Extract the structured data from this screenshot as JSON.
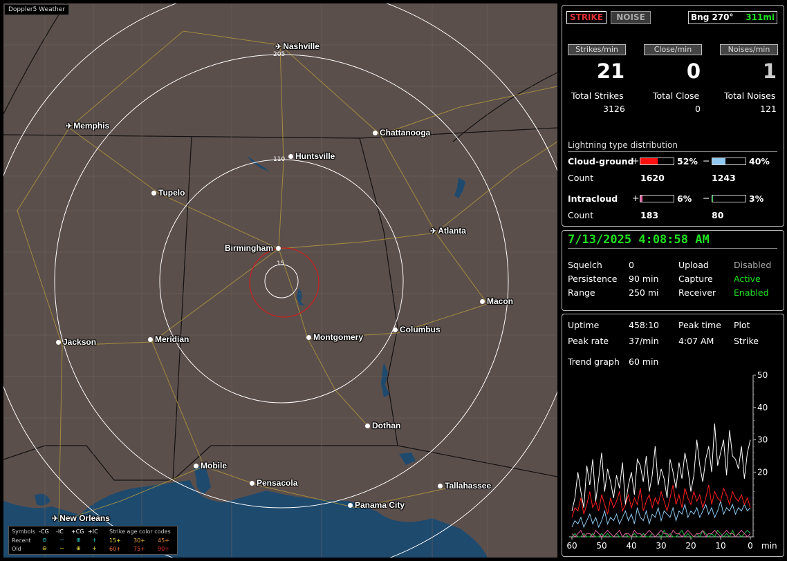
{
  "app": {
    "title": "Doppler5 Weather"
  },
  "map": {
    "cities": [
      {
        "name": "Nashville",
        "marker": "airport"
      },
      {
        "name": "Memphis",
        "marker": "airport"
      },
      {
        "name": "Chattanooga",
        "marker": "dot"
      },
      {
        "name": "Huntsville",
        "marker": "dot"
      },
      {
        "name": "Tupelo",
        "marker": "dot"
      },
      {
        "name": "Atlanta",
        "marker": "airport"
      },
      {
        "name": "Birmingham",
        "marker": "dot"
      },
      {
        "name": "Macon",
        "marker": "dot"
      },
      {
        "name": "Columbus",
        "marker": "dot"
      },
      {
        "name": "Montgomery",
        "marker": "dot"
      },
      {
        "name": "Meridian",
        "marker": "dot"
      },
      {
        "name": "Jackson",
        "marker": "dot"
      },
      {
        "name": "Dothan",
        "marker": "dot"
      },
      {
        "name": "Mobile",
        "marker": "dot"
      },
      {
        "name": "Pensacola",
        "marker": "dot"
      },
      {
        "name": "Tallahassee",
        "marker": "dot"
      },
      {
        "name": "Panama City",
        "marker": "dot"
      },
      {
        "name": "New Orleans",
        "marker": "airport"
      }
    ],
    "ring_labels": [
      "205",
      "110",
      "15"
    ],
    "colors": {
      "land": "#5b4f4c",
      "water": "#1e4a6e",
      "state_border": "#111111",
      "road": "#b59a3a",
      "ring": "#ffffff",
      "strike_range": "#cc2020"
    }
  },
  "legend": {
    "symbols_label": "Symbols",
    "minus_cg": "-CG",
    "minus_ic": "-IC",
    "plus_cg": "+CG",
    "plus_ic": "+IC",
    "age_title": "Strike age color codes",
    "recent_label": "Recent",
    "old_label": "Old",
    "recent_ages": [
      "15+",
      "30+",
      "45+"
    ],
    "old_ages": [
      "60+",
      "75+",
      "90+"
    ]
  },
  "status": {
    "strike_btn": "STRIKE",
    "noise_btn": "NOISE",
    "bearing": "Bng 270°",
    "distance": "311mi",
    "headers": {
      "strikes": "Strikes/min",
      "close": "Close/min",
      "noises": "Noises/min"
    },
    "strikes_per_min": "21",
    "close_per_min": "0",
    "noises_per_min": "1",
    "totals": {
      "strikes_label": "Total Strikes",
      "strikes": "3126",
      "close_label": "Total Close",
      "close": "0",
      "noises_label": "Total Noises",
      "noises": "121"
    }
  },
  "distribution": {
    "title": "Lightning type distribution",
    "cg_label": "Cloud-ground",
    "cg_pos_sign": "+",
    "cg_pos_pct": "52%",
    "cg_pos_value": 0.52,
    "cg_neg_sign": "−",
    "cg_neg_pct": "40%",
    "cg_neg_value": 0.4,
    "count_label": "Count",
    "cg_pos_count": "1620",
    "cg_neg_count": "1243",
    "ic_label": "Intracloud",
    "ic_pos_sign": "+",
    "ic_pos_pct": "6%",
    "ic_pos_value": 0.06,
    "ic_neg_sign": "−",
    "ic_neg_pct": "3%",
    "ic_neg_value": 0.03,
    "ic_pos_count": "183",
    "ic_neg_count": "80",
    "colors": {
      "cg_pos": "#ff1010",
      "cg_neg": "#8fc8f0",
      "ic_pos": "#e060a0",
      "ic_neg": "#20c040"
    }
  },
  "settings": {
    "datetime": "7/13/2025 4:08:58 AM",
    "squelch_label": "Squelch",
    "squelch": "0",
    "persistence_label": "Persistence",
    "persistence": "90 min",
    "range_label": "Range",
    "range": "250 mi",
    "upload_label": "Upload",
    "upload": "Disabled",
    "capture_label": "Capture",
    "capture": "Active",
    "receiver_label": "Receiver",
    "receiver": "Enabled"
  },
  "stats": {
    "uptime_label": "Uptime",
    "uptime": "458:10",
    "peak_time_label": "Peak time",
    "peak_time": "4:07 AM",
    "plot_label": "Plot",
    "plot": "Strike",
    "peak_rate_label": "Peak rate",
    "peak_rate": "37/min",
    "trend_label": "Trend graph",
    "trend": "60 min"
  },
  "chart_data": {
    "type": "line",
    "x_ticks": [
      "60",
      "50",
      "40",
      "30",
      "20",
      "10",
      "0"
    ],
    "x_unit": "min",
    "y_ticks": [
      "50",
      "40",
      "30",
      "20"
    ],
    "ylim": [
      0,
      50
    ],
    "xlim": [
      60,
      0
    ],
    "series": [
      {
        "color": "#ffffff",
        "values": [
          8,
          12,
          20,
          14,
          9,
          22,
          16,
          24,
          11,
          18,
          26,
          14,
          21,
          17,
          12,
          19,
          15,
          23,
          10,
          16,
          20,
          13,
          24,
          22,
          17,
          25,
          14,
          19,
          28,
          16,
          21,
          18,
          12,
          24,
          20,
          15,
          23,
          18,
          26,
          21,
          14,
          19,
          30,
          22,
          17,
          24,
          28,
          20,
          35,
          22,
          26,
          30,
          19,
          33,
          25,
          24,
          21,
          28,
          18,
          26,
          30
        ]
      },
      {
        "color": "#ff2020",
        "values": [
          6,
          9,
          8,
          12,
          7,
          10,
          14,
          9,
          11,
          8,
          13,
          10,
          7,
          12,
          9,
          11,
          14,
          8,
          10,
          13,
          9,
          12,
          10,
          15,
          8,
          11,
          13,
          9,
          12,
          10,
          14,
          11,
          8,
          12,
          16,
          10,
          13,
          9,
          15,
          12,
          10,
          14,
          11,
          13,
          9,
          12,
          16,
          10,
          14,
          12,
          11,
          15,
          13,
          10,
          14,
          12,
          11,
          13,
          10,
          12,
          9
        ]
      },
      {
        "color": "#8fc8f0",
        "values": [
          3,
          5,
          4,
          6,
          3,
          5,
          7,
          4,
          6,
          3,
          5,
          8,
          4,
          6,
          5,
          7,
          4,
          6,
          8,
          5,
          7,
          4,
          9,
          6,
          5,
          8,
          4,
          7,
          6,
          9,
          5,
          8,
          7,
          6,
          9,
          5,
          8,
          7,
          10,
          6,
          8,
          7,
          9,
          6,
          8,
          10,
          7,
          9,
          6,
          8,
          11,
          7,
          9,
          8,
          10,
          7,
          9,
          8,
          10,
          8,
          9
        ]
      },
      {
        "color": "#e060a0",
        "values": [
          1,
          0,
          1,
          2,
          0,
          1,
          1,
          0,
          2,
          1,
          0,
          1,
          2,
          1,
          0,
          1,
          2,
          0,
          1,
          1,
          0,
          2,
          1,
          1,
          0,
          1,
          2,
          1,
          0,
          1,
          2,
          1,
          1,
          0,
          2,
          1,
          1,
          0,
          1,
          2,
          1,
          0,
          1,
          1,
          2,
          0,
          1,
          1,
          2,
          1,
          0,
          1,
          2,
          1,
          1,
          0,
          1,
          2,
          1,
          0,
          1
        ]
      },
      {
        "color": "#20c040",
        "values": [
          0,
          1,
          0,
          0,
          1,
          0,
          0,
          1,
          0,
          0,
          1,
          0,
          1,
          0,
          0,
          1,
          0,
          0,
          1,
          0,
          0,
          1,
          0,
          0,
          1,
          0,
          0,
          1,
          0,
          1,
          0,
          2,
          0,
          1,
          0,
          0,
          1,
          2,
          0,
          1,
          0,
          0,
          1,
          0,
          2,
          1,
          0,
          1,
          0,
          2,
          1,
          0,
          1,
          0,
          2,
          0,
          1,
          0,
          1,
          2,
          1
        ]
      }
    ]
  }
}
